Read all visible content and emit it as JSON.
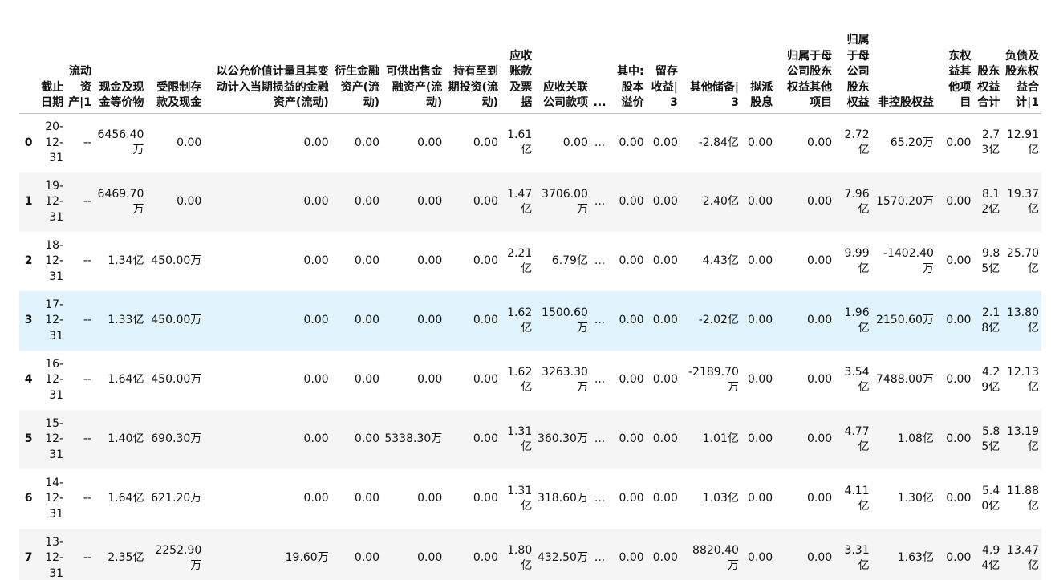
{
  "table": {
    "columns": [
      "",
      "截止日期",
      "流动资产|1",
      "现金及现金等价物",
      "受限制存款及现金",
      "以公允价值计量且其变动计入当期损益的金融资产(流动)",
      "衍生金融资产(流动)",
      "可供出售金融资产(流动)",
      "持有至到期投资(流动)",
      "应收账款及票据",
      "应收关联公司款项",
      "...",
      "其中:股本溢价",
      "留存收益|3",
      "其他储备|3",
      "拟派股息",
      "归属于母公司股东权益其他项目",
      "归属于母公司股东权益",
      "非控股权益",
      "东权益其他项目",
      "股东权益合计",
      "负债及股东权益合计|1"
    ],
    "rows": [
      [
        "0",
        "20-12-31",
        "--",
        "6456.40万",
        "0.00",
        "0.00",
        "0.00",
        "0.00",
        "0.00",
        "1.61亿",
        "0.00",
        "...",
        "0.00",
        "0.00",
        "-2.84亿",
        "0.00",
        "0.00",
        "2.72亿",
        "65.20万",
        "0.00",
        "2.73亿",
        "12.91亿"
      ],
      [
        "1",
        "19-12-31",
        "--",
        "6469.70万",
        "0.00",
        "0.00",
        "0.00",
        "0.00",
        "0.00",
        "1.47亿",
        "3706.00万",
        "...",
        "0.00",
        "0.00",
        "2.40亿",
        "0.00",
        "0.00",
        "7.96亿",
        "1570.20万",
        "0.00",
        "8.12亿",
        "19.37亿"
      ],
      [
        "2",
        "18-12-31",
        "--",
        "1.34亿",
        "450.00万",
        "0.00",
        "0.00",
        "0.00",
        "0.00",
        "2.21亿",
        "6.79亿",
        "...",
        "0.00",
        "0.00",
        "4.43亿",
        "0.00",
        "0.00",
        "9.99亿",
        "-1402.40万",
        "0.00",
        "9.85亿",
        "25.70亿"
      ],
      [
        "3",
        "17-12-31",
        "--",
        "1.33亿",
        "450.00万",
        "0.00",
        "0.00",
        "0.00",
        "0.00",
        "1.62亿",
        "1500.60万",
        "...",
        "0.00",
        "0.00",
        "-2.02亿",
        "0.00",
        "0.00",
        "1.96亿",
        "2150.60万",
        "0.00",
        "2.18亿",
        "13.80亿"
      ],
      [
        "4",
        "16-12-31",
        "--",
        "1.64亿",
        "450.00万",
        "0.00",
        "0.00",
        "0.00",
        "0.00",
        "1.62亿",
        "3263.30万",
        "...",
        "0.00",
        "0.00",
        "-2189.70万",
        "0.00",
        "0.00",
        "3.54亿",
        "7488.00万",
        "0.00",
        "4.29亿",
        "12.13亿"
      ],
      [
        "5",
        "15-12-31",
        "--",
        "1.40亿",
        "690.30万",
        "0.00",
        "0.00",
        "5338.30万",
        "0.00",
        "1.31亿",
        "360.30万",
        "...",
        "0.00",
        "0.00",
        "1.01亿",
        "0.00",
        "0.00",
        "4.77亿",
        "1.08亿",
        "0.00",
        "5.85亿",
        "13.19亿"
      ],
      [
        "6",
        "14-12-31",
        "--",
        "1.64亿",
        "621.20万",
        "0.00",
        "0.00",
        "0.00",
        "0.00",
        "1.31亿",
        "318.60万",
        "...",
        "0.00",
        "0.00",
        "1.03亿",
        "0.00",
        "0.00",
        "4.11亿",
        "1.30亿",
        "0.00",
        "5.40亿",
        "11.88亿"
      ],
      [
        "7",
        "13-12-31",
        "--",
        "2.35亿",
        "2252.90万",
        "19.60万",
        "0.00",
        "0.00",
        "0.00",
        "1.80亿",
        "432.50万",
        "...",
        "0.00",
        "0.00",
        "8820.40万",
        "0.00",
        "0.00",
        "3.31亿",
        "1.63亿",
        "0.00",
        "4.94亿",
        "13.47亿"
      ]
    ],
    "hover_row": 3,
    "colors": {
      "header_border": "#bdbdbd",
      "row_stripe": "#f5f5f5",
      "row_hover": "#e1f3fd"
    }
  }
}
